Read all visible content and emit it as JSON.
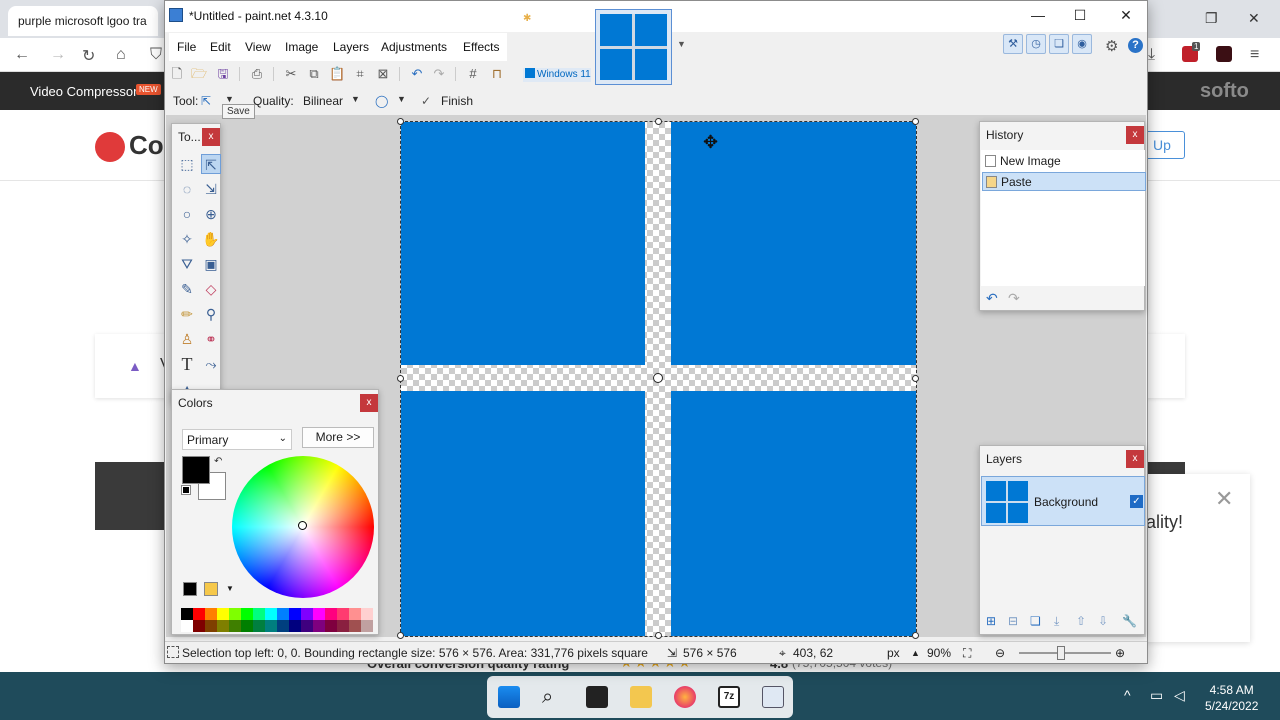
{
  "browser": {
    "tab_title": "purple microsoft lgoo tra",
    "site_nav_item": "Video Compressor",
    "site_nav_badge": "NEW",
    "site_brand_right": "softo",
    "site_logo_partial": "Co",
    "signup_partial": "Up",
    "card_letter": "V",
    "popup_text": "ality!",
    "rating_label": "Overall conversion quality rating",
    "rating_value": "4.8",
    "rating_votes": "(75,705,504 votes)"
  },
  "app": {
    "title": "*Untitled - paint.net 4.3.10",
    "menu": [
      "File",
      "Edit",
      "View",
      "Image",
      "Layers",
      "Adjustments",
      "Effects"
    ],
    "image_tab_label": "Windows 11"
  },
  "options": {
    "tool_label": "Tool:",
    "quality_label": "Quality:",
    "quality_value": "Bilinear",
    "finish_label": "Finish",
    "tooltip": "Save"
  },
  "tools_panel": {
    "title": "To..."
  },
  "colors_panel": {
    "title": "Colors",
    "mode": "Primary",
    "more_label": "More >>",
    "primary_color": "#000000",
    "secondary_color": "#ffffff"
  },
  "history_panel": {
    "title": "History",
    "items": [
      {
        "label": "New Image",
        "selected": false
      },
      {
        "label": "Paste",
        "selected": true
      }
    ]
  },
  "layers_panel": {
    "title": "Layers",
    "layers": [
      {
        "name": "Background",
        "visible": true
      }
    ]
  },
  "status": {
    "selection_info": "Selection top left: 0, 0. Bounding rectangle size: 576 × 576. Area: 331,776 pixels square",
    "image_size": "576 × 576",
    "cursor_pos": "403, 62",
    "unit": "px",
    "zoom": "90%"
  },
  "taskbar": {
    "time": "4:58 AM",
    "date": "5/24/2022"
  },
  "colors": {
    "accent_blue": "#0078d4",
    "close_red": "#c4383c",
    "taskbar": "#1f4b5b"
  }
}
